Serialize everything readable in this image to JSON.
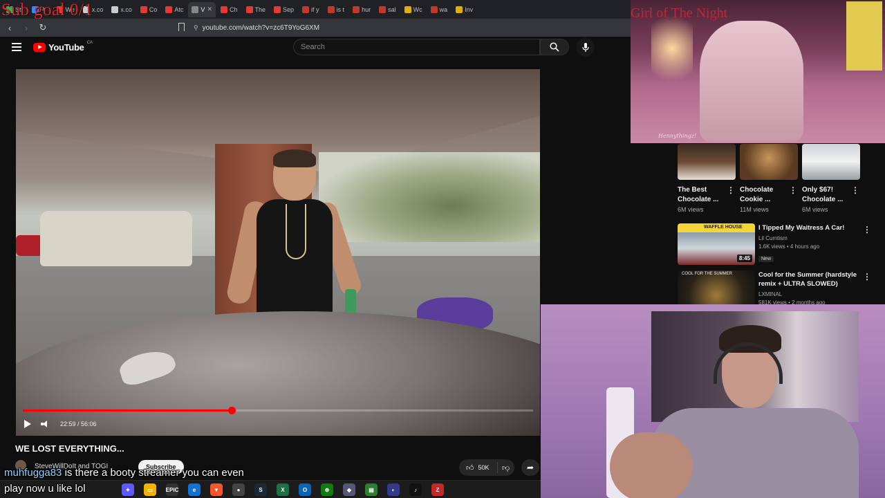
{
  "overlay": {
    "sub_goal": "Sub goal 0/1",
    "stream_top_title": "Girl of The Night",
    "stream_signature": "Hennythingz!",
    "chat_line_1_user": "muhfugga83",
    "chat_line_1_text": " is there a booty streamer you can even",
    "chat_line_2_text": "play now u like lol"
  },
  "browser": {
    "tabs": [
      {
        "label": "Str",
        "color": "#1db954",
        "active": false
      },
      {
        "label": "Pr",
        "color": "#2d8cff",
        "active": false
      },
      {
        "label": "We",
        "color": "#e53935",
        "active": false
      },
      {
        "label": "x.co",
        "color": "#cccccc",
        "active": false
      },
      {
        "label": "x.co",
        "color": "#cccccc",
        "active": false
      },
      {
        "label": "Co",
        "color": "#e53935",
        "active": false
      },
      {
        "label": "Atc",
        "color": "#e53935",
        "active": false
      },
      {
        "label": "V",
        "color": "#888888",
        "active": true
      },
      {
        "label": "Ch",
        "color": "#e53935",
        "active": false
      },
      {
        "label": "The",
        "color": "#e53935",
        "active": false
      },
      {
        "label": "Sep",
        "color": "#e53935",
        "active": false
      },
      {
        "label": "if y",
        "color": "#c0392b",
        "active": false
      },
      {
        "label": "is t",
        "color": "#c0392b",
        "active": false
      },
      {
        "label": "hur",
        "color": "#c0392b",
        "active": false
      },
      {
        "label": "sal",
        "color": "#c0392b",
        "active": false
      },
      {
        "label": "Wc",
        "color": "#e0b000",
        "active": false
      },
      {
        "label": "wa",
        "color": "#c0392b",
        "active": false
      },
      {
        "label": "Inv",
        "color": "#e0b000",
        "active": false
      }
    ],
    "url": "youtube.com/watch?v=zc6T9YoG6XM"
  },
  "youtube": {
    "logo_text": "YouTube",
    "region": "CA",
    "search_placeholder": "Search",
    "player": {
      "time_current": "22:59",
      "time_total": "56:06",
      "time_display": "22:59 / 56:06",
      "progress_fraction": 0.4097
    },
    "video_title": "WE LOST EVERYTHING...",
    "channel_name": "SteveWillDoIt and TOGI",
    "subscribe_label": "Subscribe",
    "like_count": "50K"
  },
  "recommendations": {
    "shorts": [
      {
        "title": "The Best Chocolate ...",
        "views": "6M views"
      },
      {
        "title": "Chocolate Cookie ...",
        "views": "11M views"
      },
      {
        "title": "Only $67! Chocolate ...",
        "views": "6M views"
      }
    ],
    "videos": [
      {
        "title": "I Tipped My Waitress A Car!",
        "channel": "Lil Cumtism",
        "meta": "1.6K views • 4 hours ago",
        "badge": "New",
        "duration": "8:45",
        "thumb_text": "WAFFLE HOUSE"
      },
      {
        "title": "Cool for the Summer (hardstyle remix + ULTRA SLOWED)",
        "channel": "LXMINAL",
        "meta": "581K views • 2 months ago",
        "badge": "",
        "duration": "",
        "thumb_text": "COOL FOR THE SUMMER"
      }
    ]
  },
  "taskbar": {
    "icons": [
      {
        "name": "copilot-icon",
        "glyph": "✦",
        "color": "#5a5aff"
      },
      {
        "name": "file-explorer-icon",
        "glyph": "▭",
        "color": "#f0b400"
      },
      {
        "name": "epic-games-icon",
        "glyph": "EPIC",
        "color": "#333333"
      },
      {
        "name": "edge-icon",
        "glyph": "e",
        "color": "#1273d4"
      },
      {
        "name": "brave-icon",
        "glyph": "▼",
        "color": "#fb542b"
      },
      {
        "name": "obs-icon",
        "glyph": "●",
        "color": "#444444"
      },
      {
        "name": "steam-icon",
        "glyph": "S",
        "color": "#1b2838"
      },
      {
        "name": "excel-icon",
        "glyph": "X",
        "color": "#1d7044"
      },
      {
        "name": "outlook-icon",
        "glyph": "O",
        "color": "#0a64b8"
      },
      {
        "name": "xbox-icon",
        "glyph": "⊗",
        "color": "#107c10"
      },
      {
        "name": "vpn-icon",
        "glyph": "◆",
        "color": "#555577"
      },
      {
        "name": "sheet-icon",
        "glyph": "▤",
        "color": "#2e7d32"
      },
      {
        "name": "game-icon",
        "glyph": "◐",
        "color": "#333a8c"
      },
      {
        "name": "tiktok-icon",
        "glyph": "♪",
        "color": "#111111"
      },
      {
        "name": "app-icon",
        "glyph": "Z",
        "color": "#c62828"
      }
    ]
  }
}
